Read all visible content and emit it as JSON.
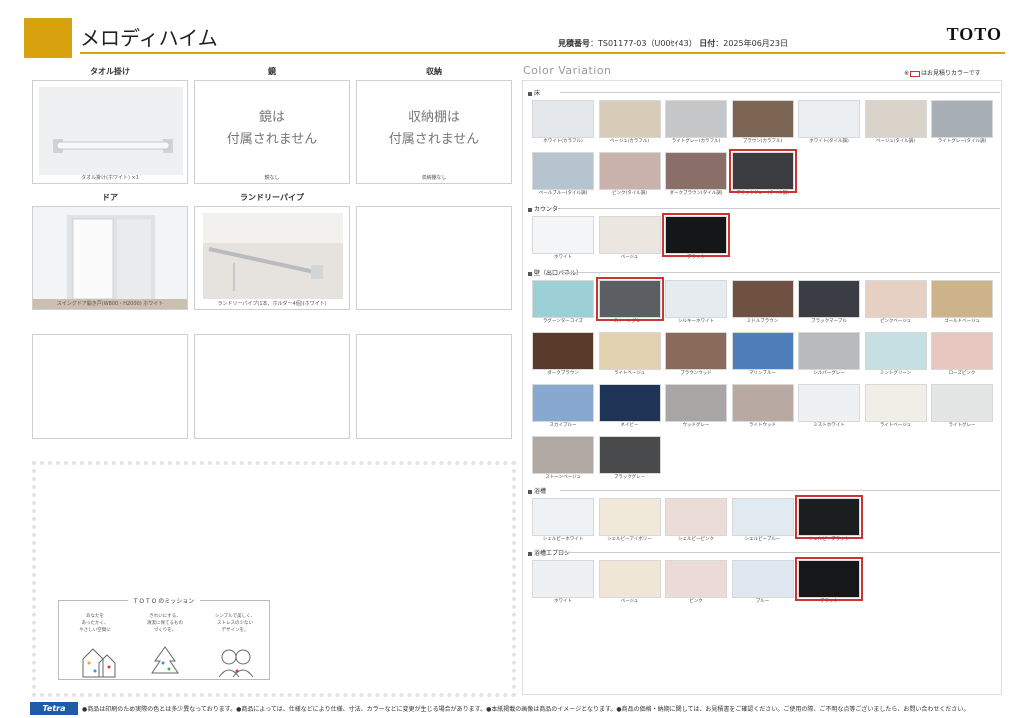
{
  "header": {
    "title": "メロディハイム",
    "estimate_label": "見積番号",
    "estimate_no": "TS01177-03",
    "estimate_tag": "（U00ｾｲ43）",
    "date_label": "日付",
    "date": "2025年06月23日",
    "logo": "TOTO"
  },
  "left": {
    "towel": {
      "label": "タオル掛け",
      "caption": "タオル掛け(ホワイト) ×1"
    },
    "mirror": {
      "label": "鏡",
      "line1": "鏡は",
      "line2": "付属されません",
      "caption": "鏡なし"
    },
    "storage": {
      "label": "収納",
      "line1": "収納棚は",
      "line2": "付属されません",
      "caption": "収納棚なし"
    },
    "door": {
      "label": "ドア",
      "caption": "スイングドア開き戸(W800・H2000) ホワイト"
    },
    "laundry": {
      "label": "ランドリーパイプ",
      "caption": "ランドリーパイプ(1本、ホルダー4個)(ホワイト)"
    }
  },
  "mission": {
    "title": "T O T O のミッション",
    "text1": "あなたを\nあったかく、\nやさしい空間に",
    "text2": "きれいにする、\n清潔に保てるもの\nづくりを。",
    "text3": "シンプルで美しく、\nストレスの少ない\nデザインを。"
  },
  "palette": {
    "title": "Color Variation",
    "legend_pre": "※",
    "legend_post": "はお見積りカラーです",
    "sections": [
      {
        "name": "床",
        "items": [
          {
            "name": "ホワイト(カラフル)",
            "color": "#e4e8ec",
            "selected": false
          },
          {
            "name": "ベージュ(カラフル)",
            "color": "#d8cbb8",
            "selected": false
          },
          {
            "name": "ライトグレー(カラフル)",
            "color": "#c4c6c8",
            "selected": false
          },
          {
            "name": "ブラウン(カラフル)",
            "color": "#7d6553",
            "selected": false
          },
          {
            "name": "ホワイト(タイル調)",
            "color": "#eceff2",
            "selected": false
          },
          {
            "name": "ベージュ(タイル調)",
            "color": "#d9d3ca",
            "selected": false
          },
          {
            "name": "ライトグレー(タイル調)",
            "color": "#a9afb6",
            "selected": false
          },
          {
            "name": "ペールブルー(タイル調)",
            "color": "#b5c4cf",
            "selected": false
          },
          {
            "name": "ピンク(タイル調)",
            "color": "#c9b2ab",
            "selected": false
          },
          {
            "name": "ダークブラウン(タイル調)",
            "color": "#8a6f68",
            "selected": false
          },
          {
            "name": "ブラックグレー(タイル調)",
            "color": "#3b3c40",
            "selected": true
          }
        ]
      },
      {
        "name": "カウンター",
        "items": [
          {
            "name": "ホワイト",
            "color": "#f4f5f6",
            "selected": false
          },
          {
            "name": "ベージュ",
            "color": "#ebe6df",
            "selected": false
          },
          {
            "name": "ブラック",
            "color": "#151617",
            "selected": true
          }
        ]
      },
      {
        "name": "壁（出口パネル）",
        "items": [
          {
            "name": "ラグーンターコイズ",
            "color": "#9cd0d6",
            "selected": false
          },
          {
            "name": "ストーングレー",
            "color": "#5b5e62",
            "selected": true
          },
          {
            "name": "シルキーホワイト",
            "color": "#e6ebf0",
            "selected": false
          },
          {
            "name": "ミドルブラウン",
            "color": "#6e5140",
            "selected": false
          },
          {
            "name": "ブラックマーブル",
            "color": "#3a3d44",
            "selected": false
          },
          {
            "name": "ピンクベージュ",
            "color": "#e6d0c4",
            "selected": false
          },
          {
            "name": "ゴールドベージュ",
            "color": "#cdb38c",
            "selected": false
          },
          {
            "name": "ダークブラウン",
            "color": "#5a3a2b",
            "selected": false
          },
          {
            "name": "ライトベージュ",
            "color": "#e2d2b0",
            "selected": false
          },
          {
            "name": "ブラウンウッド",
            "color": "#8a6a5a",
            "selected": false
          },
          {
            "name": "マリンブルー",
            "color": "#4f7fba",
            "selected": false
          },
          {
            "name": "シルバーグレー",
            "color": "#b9babb",
            "selected": false
          },
          {
            "name": "ミントグリーン",
            "color": "#c5dfe2",
            "selected": false
          },
          {
            "name": "ローズピンク",
            "color": "#e8c7c0",
            "selected": false
          },
          {
            "name": "スカイブルー",
            "color": "#87a8cf",
            "selected": false
          },
          {
            "name": "ネイビー",
            "color": "#1f3558",
            "selected": false
          },
          {
            "name": "ウッドグレー",
            "color": "#a8a5a4",
            "selected": false
          },
          {
            "name": "ライトウッド",
            "color": "#b8a9a3",
            "selected": false
          },
          {
            "name": "ミストホワイト",
            "color": "#eef1f3",
            "selected": false
          },
          {
            "name": "ライトベージュ",
            "color": "#f1ede7",
            "selected": false
          },
          {
            "name": "ライトグレー",
            "color": "#e4e6e6",
            "selected": false
          },
          {
            "name": "ストーンベージュ",
            "color": "#b1a9a1",
            "selected": false
          },
          {
            "name": "ブラックグレー",
            "color": "#494a4c",
            "selected": false
          }
        ]
      },
      {
        "name": "浴槽",
        "items": [
          {
            "name": "シェルピーホワイト",
            "color": "#eef2f5",
            "selected": false
          },
          {
            "name": "シェルピーアイボリー",
            "color": "#f0e8d8",
            "selected": false
          },
          {
            "name": "シェルピーピンク",
            "color": "#ecdcd8",
            "selected": false
          },
          {
            "name": "シェルピーブルー",
            "color": "#e1e9f1",
            "selected": false
          },
          {
            "name": "シェルピーブラック",
            "color": "#1c1d1f",
            "selected": true
          }
        ]
      },
      {
        "name": "浴槽エプロン",
        "items": [
          {
            "name": "ホワイト",
            "color": "#eef1f4",
            "selected": false
          },
          {
            "name": "ベージュ",
            "color": "#efe6d5",
            "selected": false
          },
          {
            "name": "ピンク",
            "color": "#ecdad6",
            "selected": false
          },
          {
            "name": "ブルー",
            "color": "#dfe7f0",
            "selected": false
          },
          {
            "name": "ブラック",
            "color": "#161718",
            "selected": true
          }
        ]
      }
    ]
  },
  "footer": {
    "badge": "Tetra",
    "note": "●商品は印刷のため実際の色とは多少異なっております。●商品によっては、仕様などにより仕様、寸法、カラーなどに変更が生じる場合があります。●本紙掲載の画像は商品のイメージとなります。●商品の価格・納期に関しては、お見積書をご確認ください。ご使用の際、ご不明な点等ございましたら、お問い合わせください。"
  },
  "colors": {
    "accent": "#d7a20d",
    "selected_border": "#cc3333",
    "badge": "#1f5ca8"
  }
}
